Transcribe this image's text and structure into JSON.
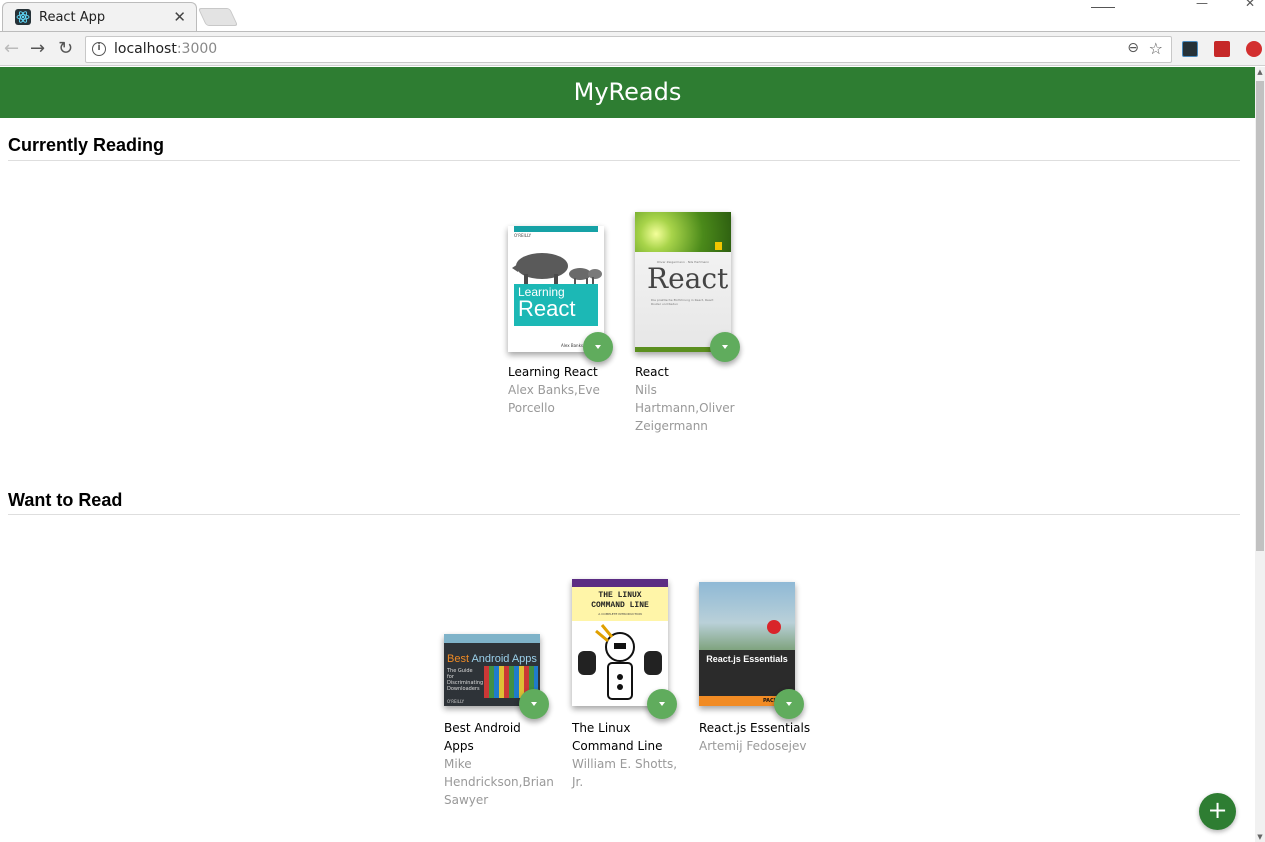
{
  "browser": {
    "tab_title": "React App",
    "tab_close": "✕",
    "back_icon": "←",
    "forward_icon": "→",
    "reload_icon": "↻",
    "url_host": "localhost",
    "url_port": ":3000",
    "info_icon": "i",
    "zoom_icon": "⊖",
    "star_icon": "☆",
    "minimize": "—",
    "maximize": "☐",
    "close": "✕"
  },
  "app": {
    "title": "MyReads",
    "open_search_label": "+"
  },
  "shelves": [
    {
      "title": "Currently Reading",
      "books": [
        {
          "title": "Learning React",
          "authors": [
            "Alex Banks,Eve",
            "Porcello"
          ]
        },
        {
          "title": "React",
          "authors": [
            "Nils",
            "Hartmann,Oliver",
            "Zeigermann"
          ]
        }
      ]
    },
    {
      "title": "Want to Read",
      "books": [
        {
          "title": [
            "Best Android",
            "Apps"
          ],
          "authors": [
            "Mike",
            "Hendrickson,Brian",
            "Sawyer"
          ]
        },
        {
          "title": [
            "The Linux",
            "Command Line"
          ],
          "authors": [
            "William E. Shotts,",
            "Jr."
          ]
        },
        {
          "title": "React.js Essentials",
          "authors": [
            "Artemij Fedosejev"
          ]
        }
      ]
    }
  ],
  "covers": {
    "learning_react": {
      "brand": "O'REILLY",
      "line1": "Learning",
      "line2": "React",
      "footer": "Alex Banks & Eve"
    },
    "react": {
      "brand": "Oliver Zeigermann · Nils Hartmann",
      "word": "React",
      "blurb": "Die praktische Einführung in React, React Router und Redux"
    },
    "best_android": {
      "line1": "Best",
      "line2": "Android Apps",
      "blurb": "The Guide for Discriminating Downloaders",
      "brand": "O'REILLY"
    },
    "linux": {
      "line1": "THE LINUX",
      "line2": "COMMAND LINE",
      "sub": "A COMPLETE INTRODUCTION"
    },
    "reactjs": {
      "title": "React.js Essentials",
      "brand": "PACKT"
    }
  },
  "colors": {
    "header_green": "#2e7d32",
    "changer_green": "#60ac5d",
    "author_gray": "#999999"
  }
}
